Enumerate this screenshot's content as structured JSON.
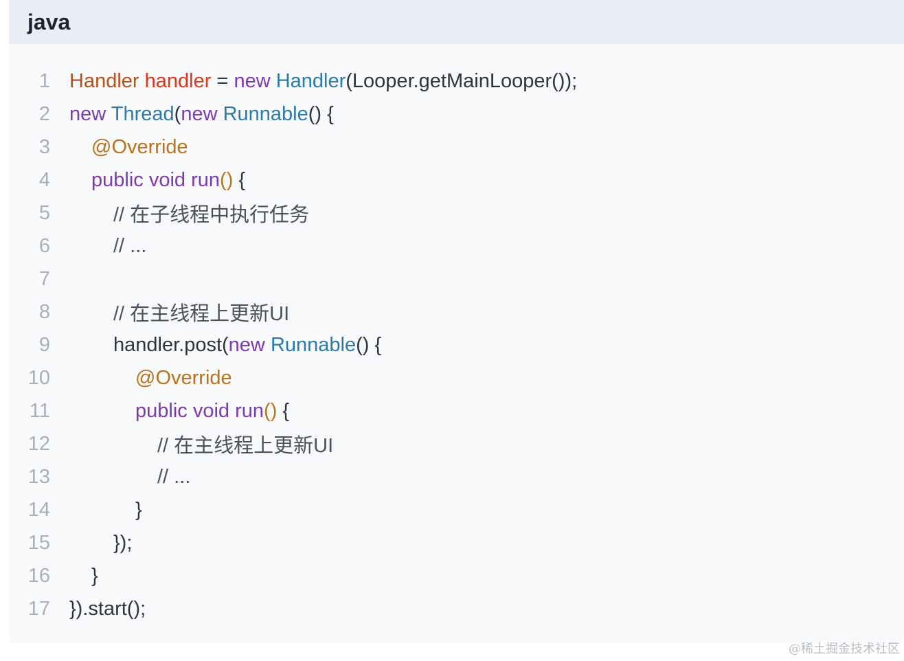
{
  "code_block": {
    "language": "java",
    "lines": [
      {
        "n": "1",
        "indent": 0,
        "tokens": [
          [
            "t-type",
            "Handler"
          ],
          [
            "t-plain",
            " "
          ],
          [
            "t-var",
            "handler"
          ],
          [
            "t-plain",
            " = "
          ],
          [
            "t-kw",
            "new"
          ],
          [
            "t-plain",
            " "
          ],
          [
            "t-cls",
            "Handler"
          ],
          [
            "t-plain",
            "(Looper.getMainLooper());"
          ]
        ]
      },
      {
        "n": "2",
        "indent": 0,
        "tokens": [
          [
            "t-kw",
            "new"
          ],
          [
            "t-plain",
            " "
          ],
          [
            "t-cls",
            "Thread"
          ],
          [
            "t-plain",
            "("
          ],
          [
            "t-kw",
            "new"
          ],
          [
            "t-plain",
            " "
          ],
          [
            "t-cls",
            "Runnable"
          ],
          [
            "t-plain",
            "() {"
          ]
        ]
      },
      {
        "n": "3",
        "indent": 1,
        "tokens": [
          [
            "t-ann",
            "@Override"
          ]
        ]
      },
      {
        "n": "4",
        "indent": 1,
        "tokens": [
          [
            "t-kw",
            "public"
          ],
          [
            "t-plain",
            " "
          ],
          [
            "t-kw",
            "void"
          ],
          [
            "t-plain",
            " "
          ],
          [
            "t-fn",
            "run"
          ],
          [
            "t-par",
            "()"
          ],
          [
            "t-plain",
            " {"
          ]
        ]
      },
      {
        "n": "5",
        "indent": 2,
        "tokens": [
          [
            "t-cmt",
            "// 在子线程中执行任务"
          ]
        ]
      },
      {
        "n": "6",
        "indent": 2,
        "tokens": [
          [
            "t-cmt",
            "// ..."
          ]
        ]
      },
      {
        "n": "7",
        "indent": 0,
        "tokens": []
      },
      {
        "n": "8",
        "indent": 2,
        "tokens": [
          [
            "t-cmt",
            "// 在主线程上更新UI"
          ]
        ]
      },
      {
        "n": "9",
        "indent": 2,
        "tokens": [
          [
            "t-plain",
            "handler.post("
          ],
          [
            "t-kw",
            "new"
          ],
          [
            "t-plain",
            " "
          ],
          [
            "t-cls",
            "Runnable"
          ],
          [
            "t-plain",
            "() {"
          ]
        ]
      },
      {
        "n": "10",
        "indent": 3,
        "tokens": [
          [
            "t-ann",
            "@Override"
          ]
        ]
      },
      {
        "n": "11",
        "indent": 3,
        "tokens": [
          [
            "t-kw",
            "public"
          ],
          [
            "t-plain",
            " "
          ],
          [
            "t-kw",
            "void"
          ],
          [
            "t-plain",
            " "
          ],
          [
            "t-fn",
            "run"
          ],
          [
            "t-par",
            "()"
          ],
          [
            "t-plain",
            " {"
          ]
        ]
      },
      {
        "n": "12",
        "indent": 4,
        "tokens": [
          [
            "t-cmt",
            "// 在主线程上更新UI"
          ]
        ]
      },
      {
        "n": "13",
        "indent": 4,
        "tokens": [
          [
            "t-cmt",
            "// ..."
          ]
        ]
      },
      {
        "n": "14",
        "indent": 3,
        "tokens": [
          [
            "t-plain",
            "}"
          ]
        ]
      },
      {
        "n": "15",
        "indent": 2,
        "tokens": [
          [
            "t-plain",
            "});"
          ]
        ]
      },
      {
        "n": "16",
        "indent": 1,
        "tokens": [
          [
            "t-plain",
            "}"
          ]
        ]
      },
      {
        "n": "17",
        "indent": 0,
        "tokens": [
          [
            "t-plain",
            "}).start();"
          ]
        ]
      }
    ]
  },
  "watermark": "@稀土掘金技术社区",
  "colors": {
    "header_bg": "#ebedf5",
    "code_bg": "#f8f9fb",
    "keyword": "#7c3aad",
    "class_name": "#2b7aa8",
    "annotation": "#b8731b",
    "type": "#b5501a",
    "variable": "#d9381e",
    "line_number": "#a9aebb"
  }
}
